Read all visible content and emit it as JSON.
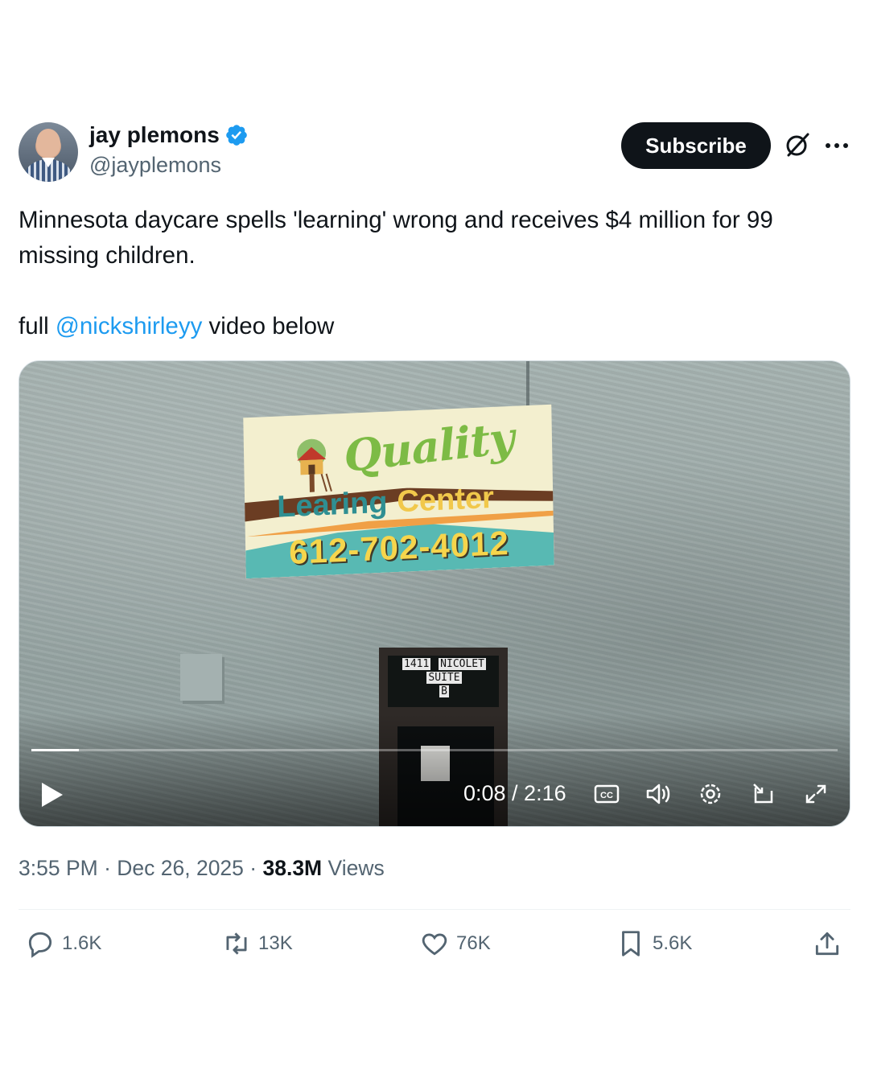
{
  "author": {
    "name": "jay plemons",
    "handle": "@jayplemons",
    "verified": true
  },
  "header": {
    "subscribe_label": "Subscribe",
    "grok_icon": "grok-icon",
    "more_icon": "more-icon"
  },
  "tweet": {
    "line1": "Minnesota daycare spells 'learning' wrong and receives $4 million for 99 missing children.",
    "line2_prefix": "full ",
    "mention": "@nickshirleyy",
    "line2_suffix": " video below"
  },
  "video": {
    "sign_word1": "Quality",
    "sign_word2": "Learing",
    "sign_word3": "Center",
    "sign_phone": "612-702-4012",
    "address_line1a": "1411",
    "address_line1b": "NICOLET",
    "address_line2": "SUITE",
    "address_line3": "B",
    "time_display": "0:08 / 2:16",
    "progress_fraction": 0.059,
    "controls": [
      "play-icon",
      "captions-icon",
      "volume-icon",
      "settings-icon",
      "pip-icon",
      "fullscreen-icon"
    ]
  },
  "meta": {
    "time": "3:55 PM",
    "sep1": " · ",
    "date": "Dec 26, 2025",
    "sep2": " · ",
    "views_count": "38.3M",
    "views_label": " Views"
  },
  "actions": {
    "replies": "1.6K",
    "reposts": "13K",
    "likes": "76K",
    "bookmarks": "5.6K"
  },
  "colors": {
    "link": "#1d9bf0",
    "verified": "#1d9bf0",
    "text": "#0f1419",
    "muted": "#536471"
  }
}
